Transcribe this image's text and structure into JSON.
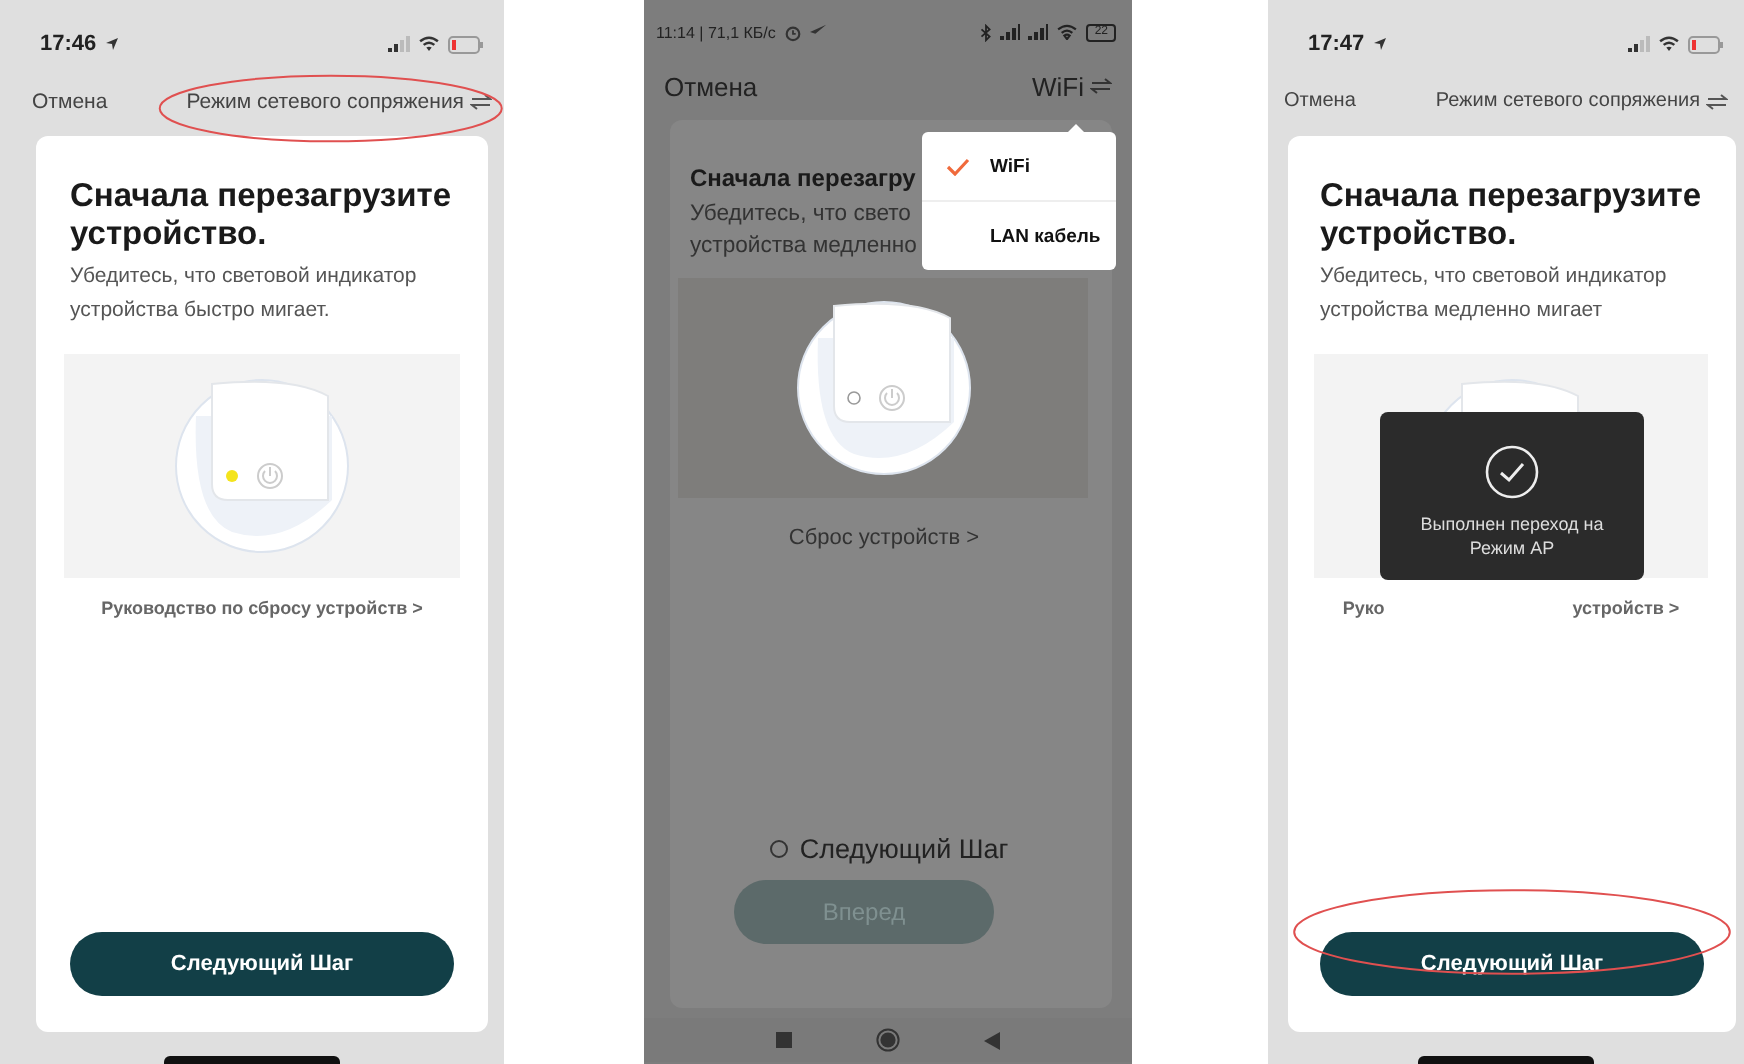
{
  "phones": [
    {
      "kind": "ios",
      "dimmed": false,
      "status": {
        "time": "17:46"
      },
      "header": {
        "cancel": "Отмена",
        "mode": "Режим сетевого сопряжения",
        "circled": true
      },
      "card": {
        "title": "Сначала перезагрузите устройство.",
        "text": "Убедитесь, что световой индикатор устройства быстро мигает.",
        "led_lit": true,
        "link": "Руководство по сбросу устройств >",
        "button": {
          "label": "Следующий Шаг",
          "disabled": false,
          "circled": false
        }
      }
    },
    {
      "kind": "android",
      "dimmed": true,
      "status": {
        "time": "11:14 | 71,1 КБ/с",
        "battery": "22"
      },
      "header": {
        "cancel": "Отмена",
        "mode": "WiFi",
        "circled": false
      },
      "card": {
        "title": "Сначала перезагру",
        "text_lines": [
          "Убедитесь, что свето",
          "устройства медленно"
        ],
        "led_lit": false,
        "link": "Сброс устройств >",
        "confirm": {
          "label": "Следующий Шаг",
          "checked": false
        },
        "button": {
          "label": "Вперед",
          "disabled": true,
          "circled": false
        }
      },
      "menu": [
        {
          "label": "WiFi",
          "selected": true
        },
        {
          "label": "LAN кабель",
          "selected": false
        }
      ]
    },
    {
      "kind": "ios",
      "dimmed": false,
      "status": {
        "time": "17:47"
      },
      "header": {
        "cancel": "Отмена",
        "mode": "Режим сетевого сопряжения",
        "circled": false
      },
      "card": {
        "title": "Сначала перезагрузите устройство.",
        "text": "Убедитесь, что световой индикатор устройства медленно мигает",
        "led_lit": false,
        "link_parts": [
          "Руко",
          "устройств >"
        ],
        "button": {
          "label": "Следующий Шаг",
          "disabled": false,
          "circled": true
        }
      },
      "toast": {
        "text": "Выполнен переход на Режим AP"
      }
    }
  ]
}
